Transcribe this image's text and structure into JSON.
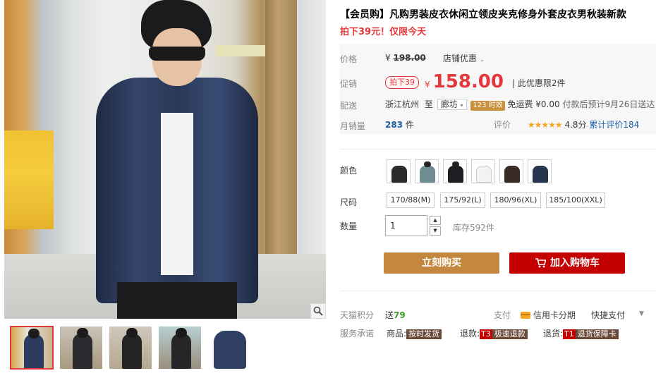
{
  "product": {
    "title": "【会员购】凡购男装皮衣休闲立领皮夹克修身外套皮衣男秋装新款",
    "promo": "拍下39元！仅限今天"
  },
  "price": {
    "orig_label": "价格",
    "currency": "¥",
    "orig_value": "198.00",
    "shop_discount": "店铺优惠",
    "promo_label": "促销",
    "promo_tag": "拍下39",
    "current_value": "158.00",
    "discount_note": "| 此优惠限2件"
  },
  "shipping": {
    "label": "配送",
    "from": "浙江杭州",
    "to_word": "至",
    "to_city": "廊坊",
    "hours": "123 时效",
    "fee": "免运费 ¥0.00",
    "eta": "付款后预计9月26日送达"
  },
  "sales": {
    "label": "月销量",
    "count": "283",
    "unit": "件",
    "rating_label": "评价",
    "stars": "★★★★★",
    "score": "4.8分",
    "cum_label": "累计评价184"
  },
  "options": {
    "color_label": "颜色",
    "colors": [
      "#2a2a2c",
      "#7aa6b3",
      "#1e1e22",
      "#f2f2f2",
      "#3a2a24",
      "#26344f"
    ],
    "size_label": "尺码",
    "sizes": [
      "170/88(M)",
      "175/92(L)",
      "180/96(XL)",
      "185/100(XXL)"
    ],
    "qty_label": "数量",
    "qty_value": "1",
    "stock": "库存592件"
  },
  "actions": {
    "buy_now": "立刻购买",
    "add_cart": "加入购物车"
  },
  "extras": {
    "points_label": "天猫积分",
    "points_prefix": "送",
    "points_value": "79",
    "pay_label": "支付",
    "credit": "信用卡分期",
    "quickpay": "快捷支付",
    "promise_label": "服务承诺",
    "goods_label": "商品:",
    "goods_badge": "按时发货",
    "refund_label": "退款:",
    "refund_code": "T3",
    "refund_badge": "极速退款",
    "return_label": "退货:",
    "return_code": "T1",
    "return_badge": "退货保障卡"
  },
  "icons": {
    "zoom": "magnifier-icon",
    "cart": "cart-icon",
    "card": "credit-card-icon"
  },
  "colors": {
    "accent_red": "#e4393c",
    "buy_button": "#c4873f",
    "cart_button": "#c40000"
  }
}
